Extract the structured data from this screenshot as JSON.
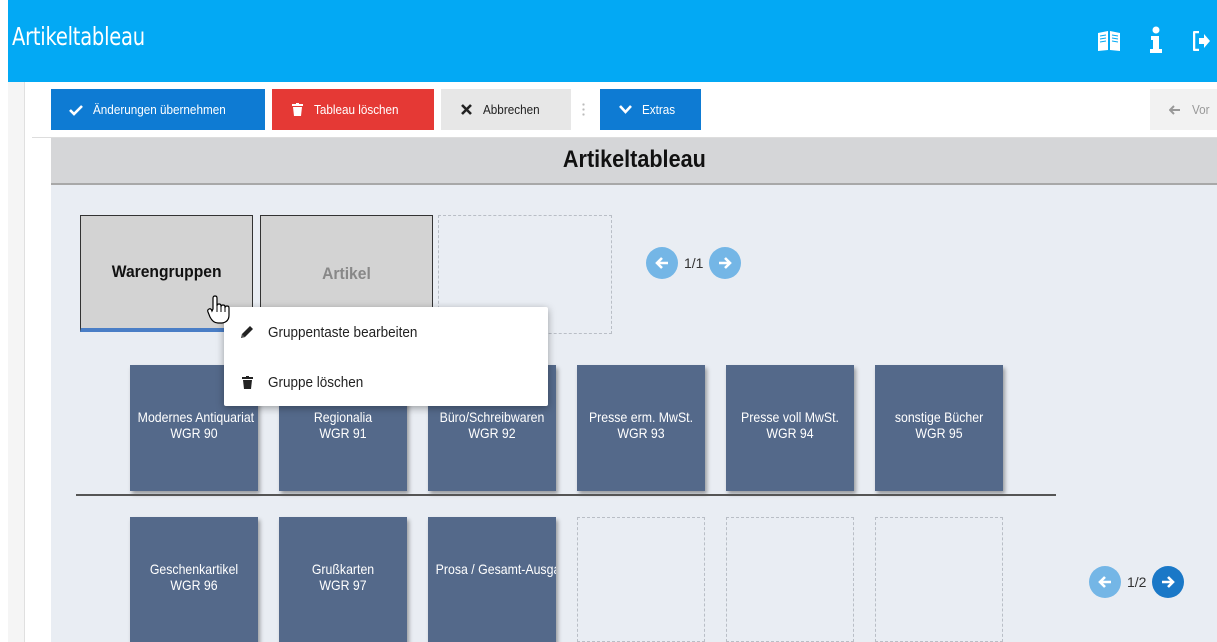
{
  "header": {
    "title": "Artikeltableau",
    "icons": [
      "book-icon",
      "info-icon",
      "logout-icon"
    ]
  },
  "toolbar": {
    "apply_label": "Änderungen übernehmen",
    "delete_label": "Tableau löschen",
    "cancel_label": "Abbrechen",
    "extras_label": "Extras",
    "next_label": "Vor"
  },
  "content": {
    "title": "Artikeltableau"
  },
  "tabs": [
    {
      "label": "Warengruppen",
      "active": true
    },
    {
      "label": "Artikel",
      "active": false
    }
  ],
  "tabs_pager": {
    "text": "1/1"
  },
  "context_menu": {
    "items": [
      {
        "label": "Gruppentaste bearbeiten",
        "icon": "pencil-icon"
      },
      {
        "label": "Gruppe löschen",
        "icon": "trash-icon"
      }
    ]
  },
  "tiles_row1": [
    {
      "name": "Modernes Antiquariat",
      "code": "WGR 90"
    },
    {
      "name": "Regionalia",
      "code": "WGR 91"
    },
    {
      "name": "Büro/Schreibwaren",
      "code": "WGR 92"
    },
    {
      "name": "Presse erm. MwSt.",
      "code": "WGR 93"
    },
    {
      "name": "Presse voll MwSt.",
      "code": "WGR 94"
    },
    {
      "name": "sonstige Bücher",
      "code": "WGR 95"
    }
  ],
  "tiles_row2": [
    {
      "name": "Geschenkartikel",
      "code": "WGR 96"
    },
    {
      "name": "Grußkarten",
      "code": "WGR 97"
    },
    {
      "name": "Prosa / Gesamt-Ausgaben",
      "code": ""
    }
  ],
  "tiles_pager": {
    "text": "1/2"
  },
  "colors": {
    "header": "#03a9f4",
    "primary": "#0e7bd3",
    "danger": "#e53935",
    "tile": "#54698a",
    "content_bg": "#e9edf3"
  }
}
